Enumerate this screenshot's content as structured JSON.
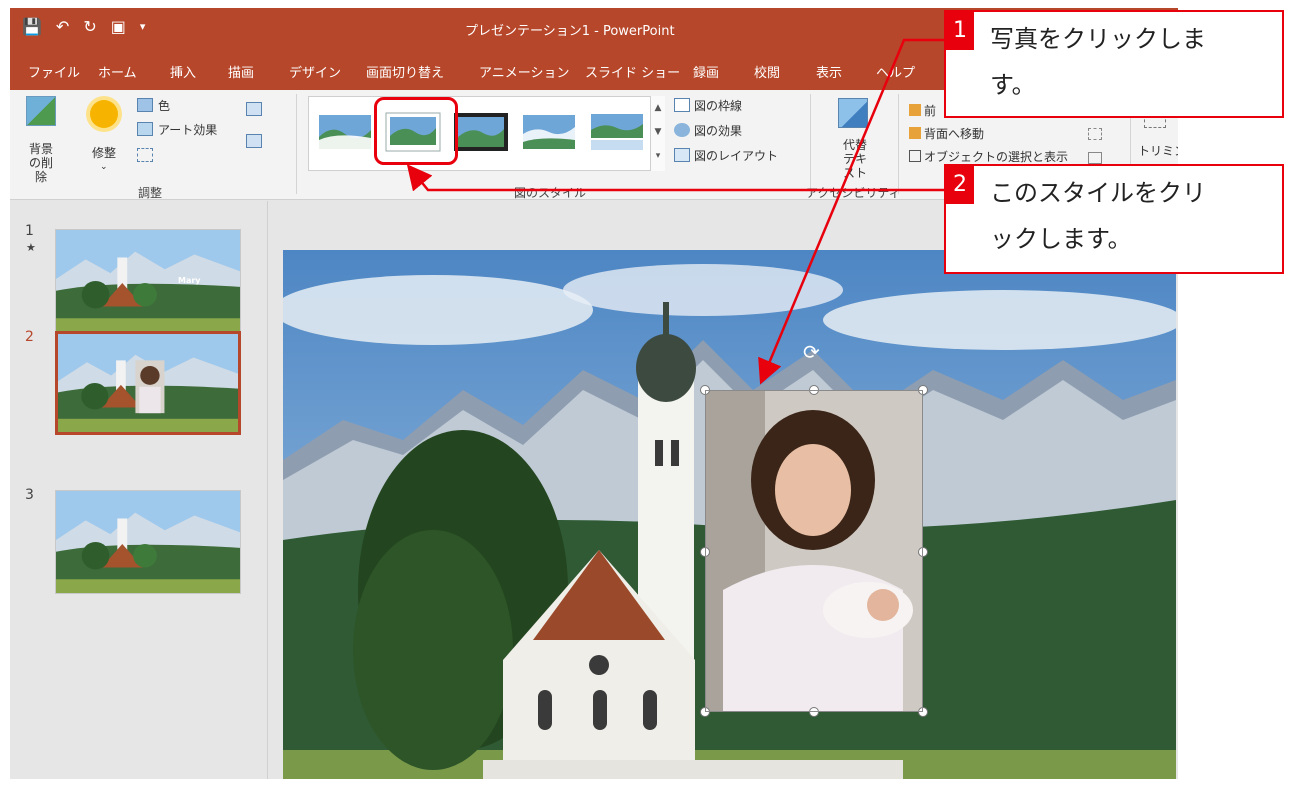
{
  "window": {
    "title": "プレゼンテーション1 - PowerPoint",
    "qat": [
      "save-icon",
      "undo-icon",
      "redo-icon",
      "presentation-icon",
      "customize-icon"
    ]
  },
  "tabs": [
    "ファイル",
    "ホーム",
    "挿入",
    "描画",
    "デザイン",
    "画面切り替え",
    "アニメーション",
    "スライド ショー",
    "録画",
    "校閲",
    "表示",
    "ヘルプ"
  ],
  "ribbon": {
    "adjust": {
      "remove_bg": "背景の削除",
      "corrections": "修整",
      "color": "色",
      "artistic": "アート効果",
      "label": "調整"
    },
    "styles": {
      "label": "図のスタイル",
      "border": "図の枠線",
      "effects": "図の効果",
      "layout": "図のレイアウト"
    },
    "accessibility": {
      "alt_text": "代替テキスト",
      "label": "アクセシビリティ"
    },
    "arrange": {
      "bring_forward": "前",
      "send_backward": "背面へ移動",
      "selection_pane": "オブジェクトの選択と表示"
    },
    "size": {
      "crop": "トリミン"
    }
  },
  "slides": [
    {
      "num": "1",
      "star": "★",
      "caption": "Mary"
    },
    {
      "num": "2"
    },
    {
      "num": "3"
    }
  ],
  "callouts": [
    {
      "num": "1",
      "line1": "写真をクリックしま",
      "line2": "す。"
    },
    {
      "num": "2",
      "line1": "このスタイルをクリ",
      "line2": "ックします。"
    }
  ],
  "colors": {
    "accent": "#b7472a",
    "callout": "#e8000d"
  }
}
